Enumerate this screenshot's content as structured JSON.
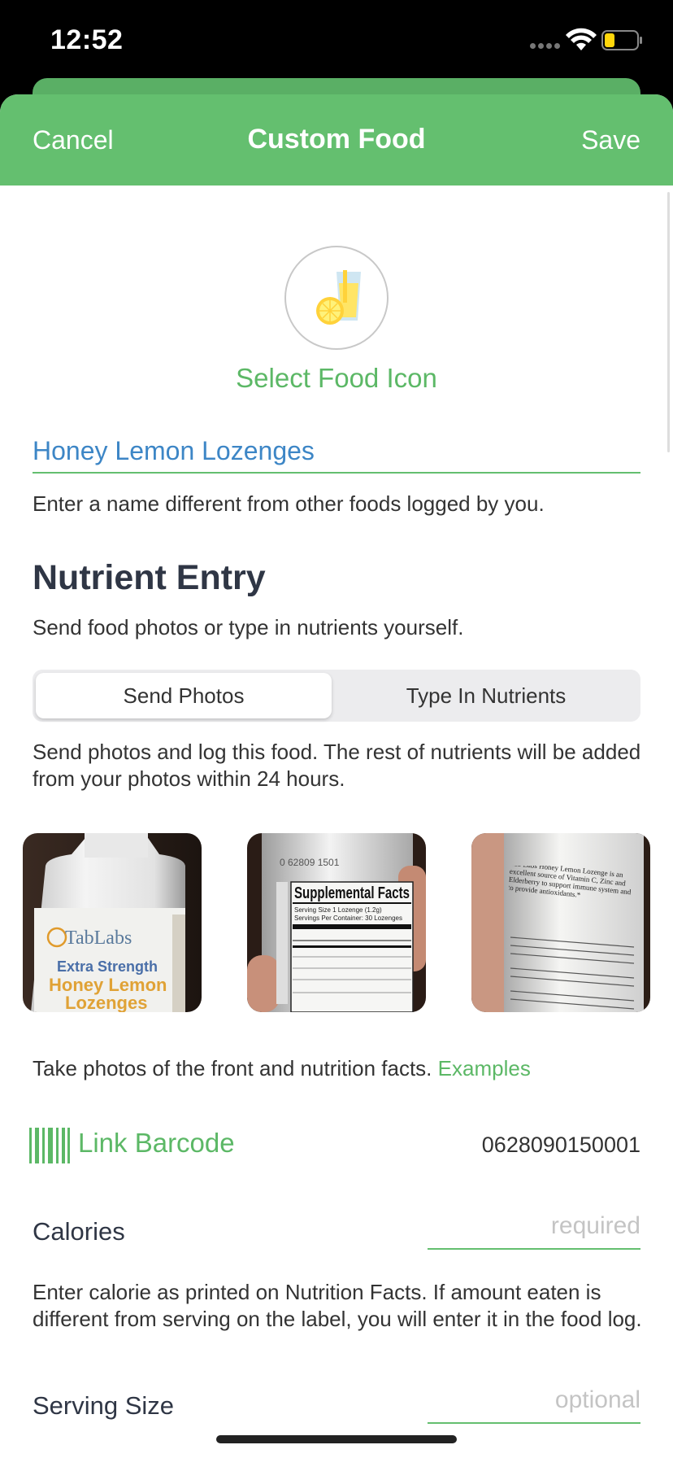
{
  "status_bar": {
    "time": "12:52",
    "icons": [
      "signal-icon",
      "wifi-icon",
      "battery-icon"
    ]
  },
  "nav": {
    "cancel_label": "Cancel",
    "title": "Custom Food",
    "save_label": "Save"
  },
  "food_icon": {
    "name": "lemonade-icon",
    "select_label": "Select Food Icon"
  },
  "food_name": {
    "value": "Honey Lemon Lozenges",
    "hint": "Enter a name different from other foods logged by you."
  },
  "nutrient_entry": {
    "title": "Nutrient Entry",
    "subtitle": "Send food photos or type in nutrients yourself.",
    "segments": [
      {
        "label": "Send Photos",
        "selected": true
      },
      {
        "label": "Type In Nutrients",
        "selected": false
      }
    ],
    "description": "Send photos and log this food. The rest of nutrients will be added from your photos within 24 hours."
  },
  "photos": {
    "front": {
      "brand": "TabLabs",
      "line1": "Extra Strength",
      "line2": "Honey Lemon",
      "line3": "Lozenges"
    },
    "facts": {
      "heading": "Supplemental Facts",
      "serving_size": "Serving Size 1 Lozenge (1.2g)",
      "servings_per_container": "Servings Per Container: 30 Lozenges"
    },
    "back": {
      "text": "Tab Labs Honey Lemon Lozenge is an excellent source of Vitamin C, Zinc and Elderberry to support immune system and to provide antioxidants.*"
    },
    "hint": "Take photos of the front and nutrition facts.",
    "examples_label": "Examples"
  },
  "barcode": {
    "link_label": "Link Barcode",
    "value": "0628090150001"
  },
  "calories": {
    "label": "Calories",
    "placeholder": "required",
    "description": "Enter calorie as printed on Nutrition Facts. If amount eaten is different from serving on the label, you will enter it in the food log."
  },
  "serving_size": {
    "label": "Serving Size",
    "placeholder": "optional"
  },
  "colors": {
    "accent": "#64bf6f",
    "link_green": "#5cb866",
    "name_blue": "#3d86c6",
    "title_dark": "#2f3645"
  }
}
